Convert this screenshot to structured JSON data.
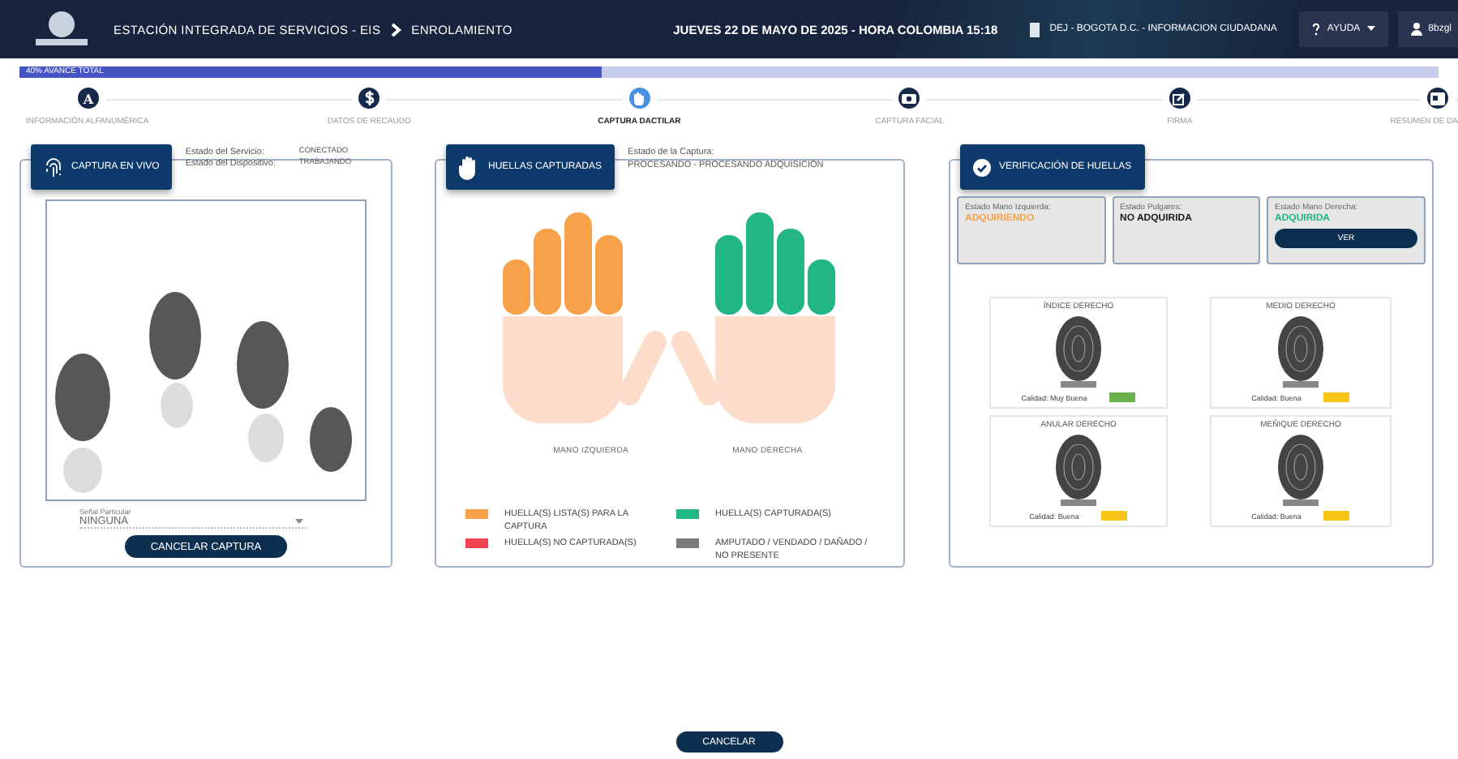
{
  "header": {
    "title": "ESTACIÓN INTEGRADA DE SERVICIOS - EIS",
    "section": "ENROLAMIENTO",
    "datetime": "JUEVES 22 DE MAYO DE 2025 - HORA COLOMBIA 15:18",
    "office": "DEJ - BOGOTA D.C. - INFORMACION CIUDADANA",
    "help": "AYUDA",
    "user": "8bzgl"
  },
  "progress": {
    "label": "40% AVANCE TOTAL",
    "level": 0.41
  },
  "steps": [
    {
      "label": "INFORMACIÓN ALFANUMÉRICA",
      "kind": "letter",
      "glyph": "A",
      "selected": false
    },
    {
      "label": "DATOS DE RECAUDO",
      "kind": "money",
      "selected": false
    },
    {
      "label": "CAPTURA DACTILAR",
      "kind": "hand",
      "selected": true
    },
    {
      "label": "CAPTURA FACIAL",
      "kind": "camera",
      "selected": false
    },
    {
      "label": "FIRMA",
      "kind": "pen",
      "selected": false
    },
    {
      "label": "RESUMEN DE DA",
      "kind": "summary",
      "selected": false
    }
  ],
  "live_capture": {
    "title": "CAPTURA EN VIVO",
    "status": [
      {
        "label": "Estado del Servicio:",
        "value": "CONECTADO"
      },
      {
        "label": "Estado del Dispositivo:",
        "value": "TRABAJANDO"
      }
    ],
    "mark_field": {
      "label": "Señal Particular",
      "value": "NINGUNA"
    },
    "button": "CANCELAR CAPTURA"
  },
  "captured": {
    "title": "HUELLAS CAPTURADAS",
    "status_label": "Estado de la Captura:",
    "status_value": "PROCESANDO - PROCESANDO ADQUISICIÓN",
    "hands": [
      {
        "label": "MANO IZQUIERDA",
        "fingers": [
          {
            "color": "#f7a14a"
          },
          {
            "color": "#f7a14a"
          },
          {
            "color": "#f7a14a"
          },
          {
            "color": "#f7a14a"
          }
        ]
      },
      {
        "label": "MANO DERECHA",
        "fingers": [
          {
            "color": "#22b585"
          },
          {
            "color": "#22b585"
          },
          {
            "color": "#22b585"
          },
          {
            "color": "#22b585"
          }
        ]
      }
    ],
    "legend": [
      {
        "label": "HUELLA(S) LISTA(S) PARA LA CAPTURA",
        "color": "#f7a14a"
      },
      {
        "label": "HUELLA(S) CAPTURADA(S)",
        "color": "#22b585"
      },
      {
        "label": "HUELLA(S) NO CAPTURADA(S)",
        "color": "#ee4452"
      },
      {
        "label": "AMPUTADO / VENDADO / DAÑADO / NO PRESENTE",
        "color": "#7a7a7a"
      }
    ]
  },
  "verification": {
    "title": "VERIFICACIÓN DE HUELLAS",
    "states": [
      {
        "label": "Estado Mano Izquierda:",
        "value": "ADQUIRIENDO",
        "color": "#f7a14a"
      },
      {
        "label": "Estado Pulgares:",
        "value": "NO ADQUIRIDA",
        "color": "#1a1a1a"
      },
      {
        "label": "Estado Mano Derecha:",
        "value": "ADQUIRIDA",
        "color": "#22b585",
        "button": "VER"
      }
    ],
    "fingers": [
      {
        "title": "ÍNDICE DERECHO",
        "quality": "Calidad: Muy Buena",
        "color": "#6ab04c"
      },
      {
        "title": "MEDIO DERECHO",
        "quality": "Calidad: Buena",
        "color": "#f5c518"
      },
      {
        "title": "ANULAR DERECHO",
        "quality": "Calidad: Buena",
        "color": "#f5c518"
      },
      {
        "title": "MEÑIQUE DERECHO",
        "quality": "Calidad: Buena",
        "color": "#f5c518"
      }
    ]
  },
  "footer_button": "CANCELAR"
}
